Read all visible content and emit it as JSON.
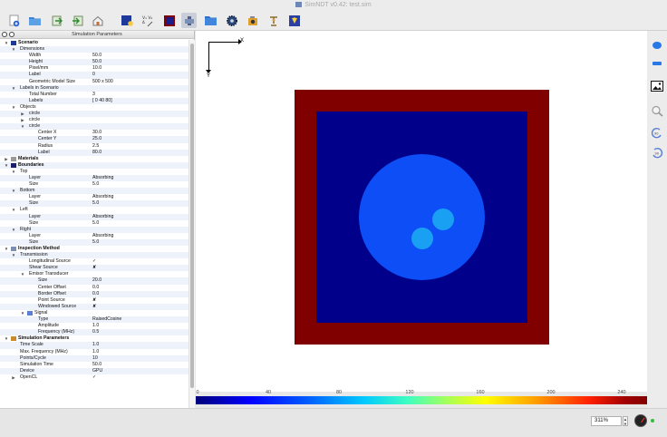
{
  "window": {
    "title": "SimNDT v0.42: test.sim"
  },
  "toolbar": {
    "icons": [
      "new-file-icon",
      "open-folder-icon",
      "export-icon",
      "import-icon",
      "home-icon",
      "scenario-icon",
      "signal-settings-icon",
      "boundary-icon",
      "material-icon",
      "folder-icon",
      "gear-icon",
      "render-icon",
      "tools-icon",
      "run-simulation-icon"
    ]
  },
  "panel": {
    "title": "Simulation Parameters",
    "rows": [
      {
        "depth": 0,
        "arrow": "▼",
        "icon": "#1d3a9b",
        "label": "Scenario",
        "bold": true,
        "value": ""
      },
      {
        "depth": 1,
        "arrow": "▼",
        "label": "Dimensions",
        "value": ""
      },
      {
        "depth": 2,
        "label": "Width",
        "value": "50.0"
      },
      {
        "depth": 2,
        "label": "Height",
        "value": "50.0"
      },
      {
        "depth": 2,
        "label": "Pixel/mm",
        "value": "10.0"
      },
      {
        "depth": 2,
        "label": "Label",
        "value": "0"
      },
      {
        "depth": 2,
        "label": "Geometric Model Size",
        "value": "500 x 500"
      },
      {
        "depth": 1,
        "arrow": "▼",
        "label": "Labels in Scenario",
        "value": ""
      },
      {
        "depth": 2,
        "label": "Total Number",
        "value": "3"
      },
      {
        "depth": 2,
        "label": "Labels",
        "value": "[ 0 40 80]"
      },
      {
        "depth": 1,
        "arrow": "▼",
        "label": "Objects",
        "value": ""
      },
      {
        "depth": 2,
        "arrow": "▶",
        "label": "circle",
        "value": ""
      },
      {
        "depth": 2,
        "arrow": "▶",
        "label": "circle",
        "value": ""
      },
      {
        "depth": 2,
        "arrow": "▼",
        "label": "circle",
        "value": ""
      },
      {
        "depth": 3,
        "label": "Center X",
        "value": "30.0"
      },
      {
        "depth": 3,
        "label": "Center Y",
        "value": "25.0"
      },
      {
        "depth": 3,
        "label": "Radius",
        "value": "2.5"
      },
      {
        "depth": 3,
        "label": "Label",
        "value": "80.0"
      },
      {
        "depth": 0,
        "arrow": "▶",
        "icon": "#9a9a9a",
        "label": "Materials",
        "bold": true,
        "value": ""
      },
      {
        "depth": 0,
        "arrow": "▼",
        "icon": "#1d1d6e",
        "label": "Boundaries",
        "bold": true,
        "value": ""
      },
      {
        "depth": 1,
        "arrow": "▼",
        "label": "Top",
        "value": ""
      },
      {
        "depth": 2,
        "label": "Layer",
        "value": "Absorbing"
      },
      {
        "depth": 2,
        "label": "Size",
        "value": "5.0"
      },
      {
        "depth": 1,
        "arrow": "▼",
        "label": "Bottom",
        "value": ""
      },
      {
        "depth": 2,
        "label": "Layer",
        "value": "Absorbing"
      },
      {
        "depth": 2,
        "label": "Size",
        "value": "5.0"
      },
      {
        "depth": 1,
        "arrow": "▼",
        "label": "Left",
        "value": ""
      },
      {
        "depth": 2,
        "label": "Layer",
        "value": "Absorbing"
      },
      {
        "depth": 2,
        "label": "Size",
        "value": "5.0"
      },
      {
        "depth": 1,
        "arrow": "▼",
        "label": "Right",
        "value": ""
      },
      {
        "depth": 2,
        "label": "Layer",
        "value": "Absorbing"
      },
      {
        "depth": 2,
        "label": "Size",
        "value": "5.0"
      },
      {
        "depth": 0,
        "arrow": "▼",
        "icon": "#7b8fb5",
        "label": "Inspection Method",
        "bold": true,
        "value": ""
      },
      {
        "depth": 1,
        "arrow": "▼",
        "label": "Transmission",
        "value": ""
      },
      {
        "depth": 2,
        "label": "Longitudinal Source",
        "value": "✓"
      },
      {
        "depth": 2,
        "label": "Shear Source",
        "value": "✘"
      },
      {
        "depth": 2,
        "arrow": "▼",
        "label": "Emisor Transducer",
        "value": ""
      },
      {
        "depth": 3,
        "label": "Size",
        "value": "20.0"
      },
      {
        "depth": 3,
        "label": "Center Offset",
        "value": "0.0"
      },
      {
        "depth": 3,
        "label": "Border Offset",
        "value": "0.0"
      },
      {
        "depth": 3,
        "label": "Point Source",
        "value": "✘"
      },
      {
        "depth": 3,
        "label": "Windowed Source",
        "value": "✘"
      },
      {
        "depth": 2,
        "arrow": "▼",
        "icon": "#5a7fd6",
        "label": "Signal",
        "value": ""
      },
      {
        "depth": 3,
        "label": "Type",
        "value": "RaisedCosine"
      },
      {
        "depth": 3,
        "label": "Amplitude",
        "value": "1.0"
      },
      {
        "depth": 3,
        "label": "Frequency (MHz)",
        "value": "0.5"
      },
      {
        "depth": 0,
        "arrow": "▼",
        "icon": "#c98a2c",
        "label": "Simulation Parameters",
        "bold": true,
        "value": ""
      },
      {
        "depth": 1,
        "label": "Time Scale",
        "value": "1.0"
      },
      {
        "depth": 1,
        "label": "Max. Frequency (MHz)",
        "value": "1.0"
      },
      {
        "depth": 1,
        "label": "Points/Cycle",
        "value": "10"
      },
      {
        "depth": 1,
        "label": "Simulation Time",
        "value": "50.0"
      },
      {
        "depth": 1,
        "label": "Device",
        "value": "GPU"
      },
      {
        "depth": 1,
        "arrow": "▶",
        "label": "OpenCL",
        "value": "✓"
      }
    ]
  },
  "viewer": {
    "axis_x_label": "X",
    "axis_y_label": "Y",
    "colors": {
      "boundary": "#800000",
      "background_material": "#00008a",
      "large_circle": "#0d4ef6",
      "small_circle": "#1aa0f3"
    },
    "colorbar_ticks": [
      "0",
      "40",
      "80",
      "120",
      "160",
      "200",
      "240"
    ]
  },
  "rightbar": {
    "icons": [
      "zoom-in-icon",
      "zoom-out-icon",
      "image-icon",
      "magnifier-icon",
      "rotate-ccw-90-icon",
      "rotate-cw-90-icon"
    ]
  },
  "status": {
    "zoom": "311%"
  }
}
